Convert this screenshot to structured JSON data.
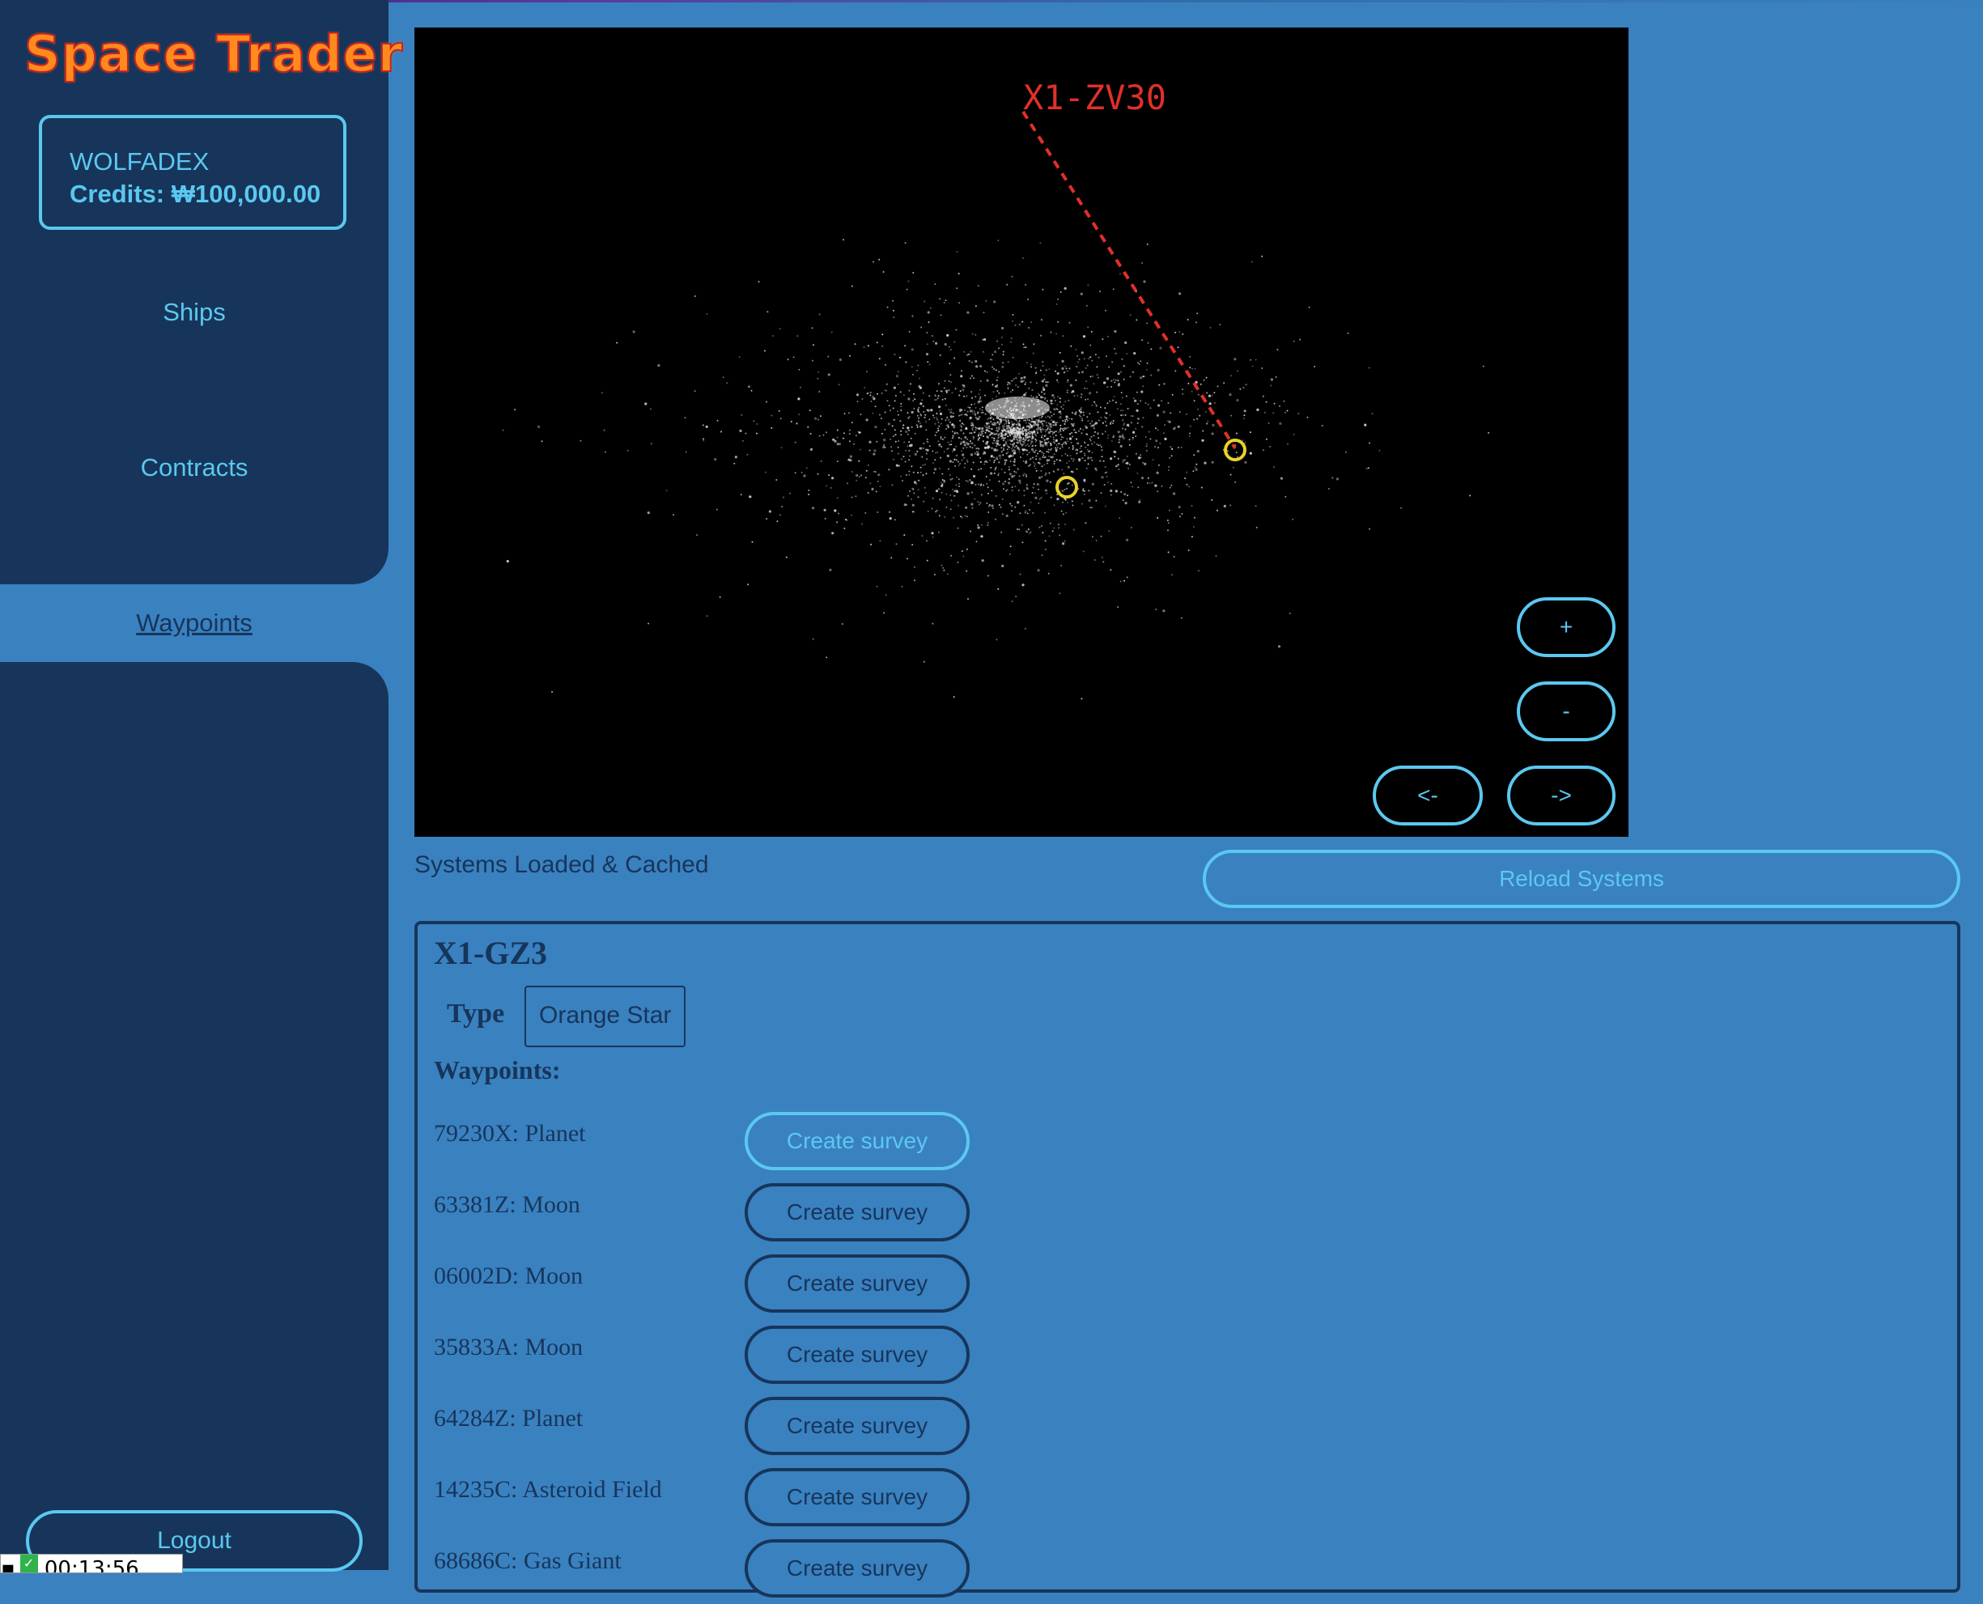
{
  "app": {
    "title": "Space Trader"
  },
  "account": {
    "name": "WOLFADEX",
    "credits_label": "Credits:",
    "credits_value": "₩100,000.00"
  },
  "nav": {
    "ships": "Ships",
    "contracts": "Contracts",
    "waypoints": "Waypoints",
    "logout": "Logout"
  },
  "clock": {
    "time": "00:13:56"
  },
  "map": {
    "system_label": "X1-ZV30",
    "zoom_in": "+",
    "zoom_out": "-",
    "prev": "<-",
    "next": "->",
    "route_color": "#e0302a",
    "marker_color": "#e8d22a"
  },
  "status": {
    "text": "Systems Loaded & Cached",
    "reload_label": "Reload Systems"
  },
  "system": {
    "name": "X1-GZ3",
    "type_label": "Type",
    "type_value": "Orange Star",
    "waypoints_label": "Waypoints:",
    "survey_label": "Create survey",
    "waypoints": [
      {
        "name": "79230X: Planet"
      },
      {
        "name": "63381Z: Moon"
      },
      {
        "name": "06002D: Moon"
      },
      {
        "name": "35833A: Moon"
      },
      {
        "name": "64284Z: Planet"
      },
      {
        "name": "14235C: Asteroid Field"
      },
      {
        "name": "68686C: Gas Giant"
      }
    ]
  },
  "colors": {
    "sidebar": "#17355a",
    "background": "#3a81c0",
    "accent": "#5bc8f0",
    "logo": "#ff8a1e"
  }
}
